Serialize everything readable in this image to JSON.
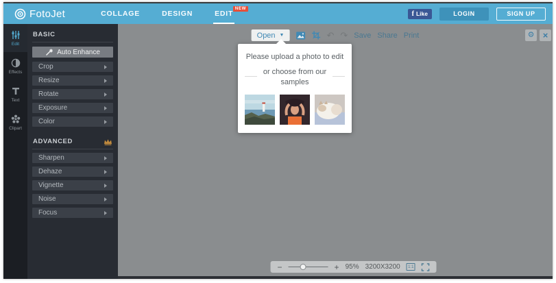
{
  "header": {
    "logo_text": "FotoJet",
    "nav": [
      {
        "label": "COLLAGE"
      },
      {
        "label": "DESIGN"
      },
      {
        "label": "EDIT",
        "badge": "NEW",
        "active": true
      }
    ],
    "fb_like_label": "Like",
    "login_label": "LOGIN",
    "signup_label": "SIGN UP"
  },
  "rail": {
    "items": [
      {
        "label": "Edit",
        "icon": "sliders-icon",
        "active": true
      },
      {
        "label": "Effects",
        "icon": "half-circle-icon"
      },
      {
        "label": "Text",
        "icon": "letter-t-icon"
      },
      {
        "label": "Clipart",
        "icon": "flower-icon"
      }
    ]
  },
  "panel": {
    "basic": {
      "title": "BASIC",
      "enhance_label": "Auto Enhance",
      "items": [
        "Crop",
        "Resize",
        "Rotate",
        "Exposure",
        "Color"
      ]
    },
    "advanced": {
      "title": "ADVANCED",
      "crown_icon": "crown-icon",
      "items": [
        "Sharpen",
        "Dehaze",
        "Vignette",
        "Noise",
        "Focus"
      ]
    }
  },
  "toolbar": {
    "open_label": "Open",
    "icons": [
      "image-icon",
      "crop-icon",
      "undo-icon",
      "redo-icon"
    ],
    "undo_glyph": "↶",
    "redo_glyph": "↷",
    "save_label": "Save",
    "share_label": "Share",
    "print_label": "Print",
    "gear_glyph": "⚙",
    "close_glyph": "×"
  },
  "popup": {
    "line1": "Please upload a photo to edit",
    "line2": "or choose from our samples",
    "samples": [
      "seascape-lighthouse",
      "woman-portrait",
      "white-cat"
    ]
  },
  "statusbar": {
    "zoom_level": "95%",
    "canvas_size": "3200X3200",
    "actual_size_label": "1:1",
    "minus_glyph": "−",
    "plus_glyph": "+"
  },
  "colors": {
    "header_blue": "#55add3",
    "accent_blue": "#4089b4",
    "panel_dark": "#282c33",
    "rail_dark": "#1b1e23",
    "canvas_gray": "#8a8d8f",
    "badge_red": "#e8503a",
    "crown_gold": "#c08a3e",
    "facebook_blue": "#3a5795"
  }
}
